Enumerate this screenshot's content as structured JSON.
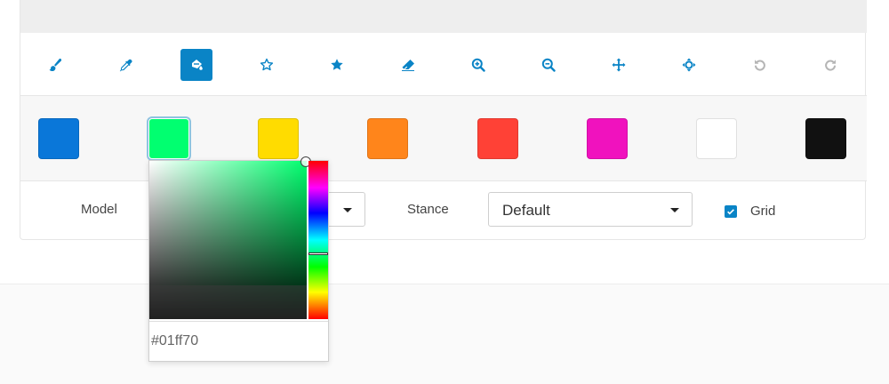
{
  "toolbar": {
    "tools": [
      {
        "icon": "paintbrush-icon",
        "active": false
      },
      {
        "icon": "eyedropper-icon",
        "active": false
      },
      {
        "icon": "fill-bucket-icon",
        "active": true
      },
      {
        "icon": "star-outline-icon",
        "active": false
      },
      {
        "icon": "star-filled-icon",
        "active": false
      },
      {
        "icon": "eraser-icon",
        "active": false
      },
      {
        "icon": "zoom-in-icon",
        "active": false
      },
      {
        "icon": "zoom-out-icon",
        "active": false
      },
      {
        "icon": "move-icon",
        "active": false
      },
      {
        "icon": "reset-position-icon",
        "active": false
      },
      {
        "icon": "undo-icon",
        "active": false,
        "disabled": true
      },
      {
        "icon": "redo-icon",
        "active": false,
        "disabled": true
      }
    ],
    "accent_color": "#0a84c6"
  },
  "palette": {
    "swatches": [
      "#0a77d9",
      "#01ff70",
      "#ffdc00",
      "#ff851b",
      "#ff4136",
      "#f012be",
      "#ffffff",
      "#111111"
    ],
    "selected_index": 1
  },
  "controls": {
    "model_label": "Model",
    "stance_label": "Stance",
    "stance_value": "Default",
    "grid_label": "Grid",
    "grid_checked": true
  },
  "color_picker": {
    "hex_value": "#01ff70"
  }
}
